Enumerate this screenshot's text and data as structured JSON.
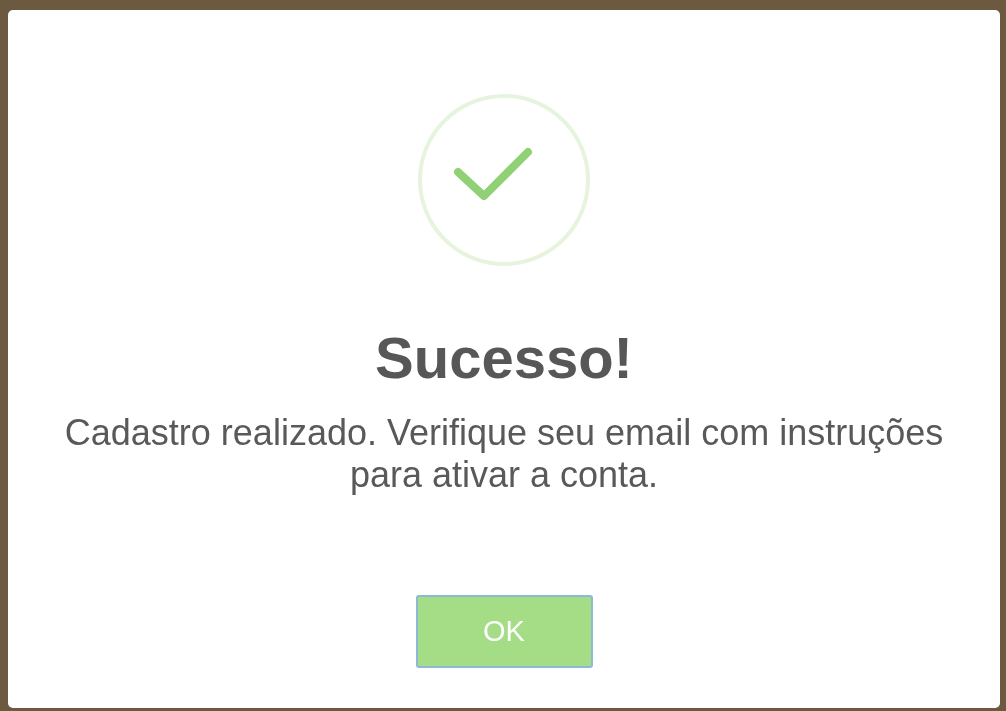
{
  "dialog": {
    "kind": "success",
    "title": "Sucesso!",
    "message": "Cadastro realizado. Verifique seu email com instruções para ativar a conta.",
    "buttons": [
      {
        "label": "OK"
      }
    ]
  }
}
